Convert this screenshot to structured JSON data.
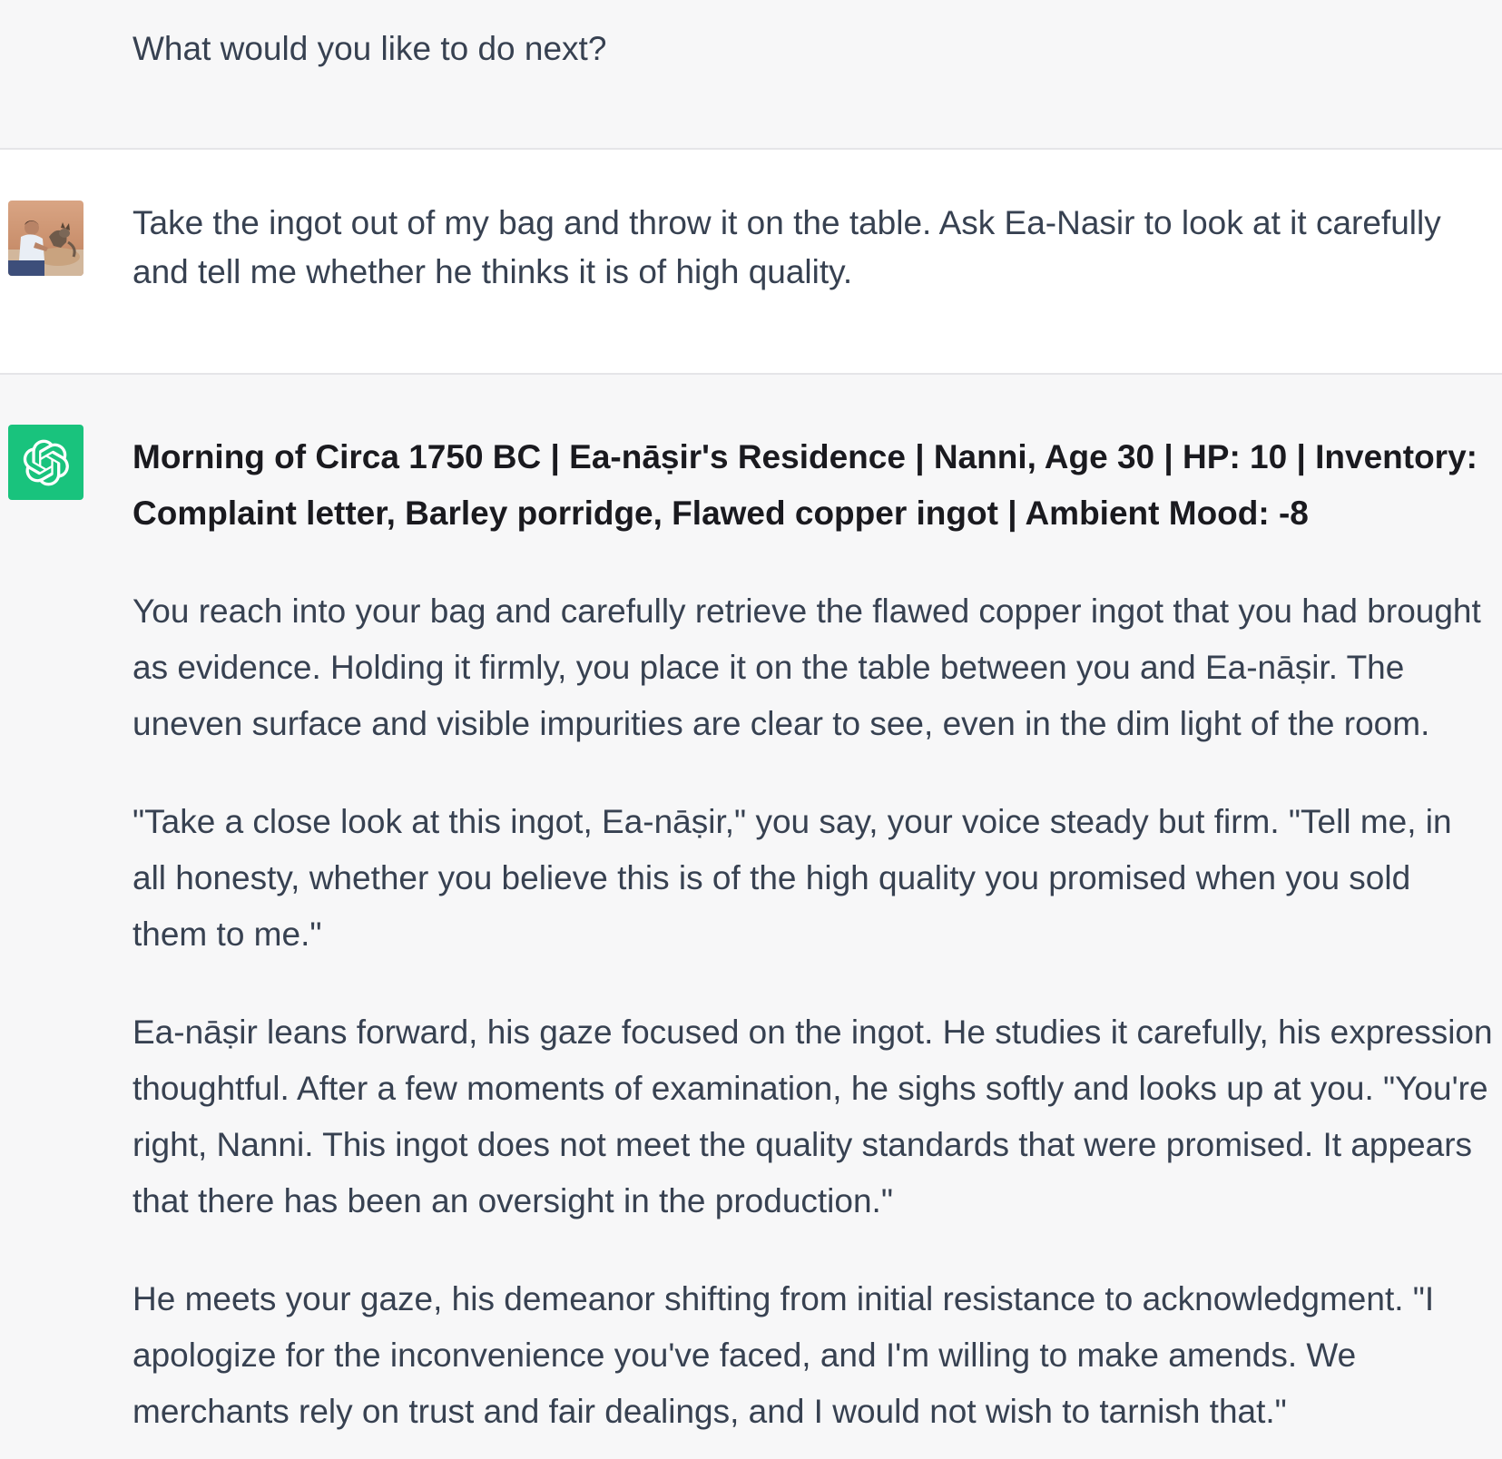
{
  "thread": {
    "previous_assistant_tail": "What would you like to do next?",
    "user_message": "Take the ingot out of my bag and throw it on the table. Ask Ea-Nasir to look at it carefully and tell me whether he thinks it is of high quality.",
    "assistant_reply": {
      "status_line": "Morning of Circa 1750 BC | Ea-nāṣir's Residence | Nanni, Age 30 | HP: 10 | Inventory: Complaint letter, Barley porridge, Flawed copper ingot | Ambient Mood: -8",
      "paragraphs": [
        "You reach into your bag and carefully retrieve the flawed copper ingot that you had brought as evidence. Holding it firmly, you place it on the table between you and Ea-nāṣir. The uneven surface and visible impurities are clear to see, even in the dim light of the room.",
        "\"Take a close look at this ingot, Ea-nāṣir,\" you say, your voice steady but firm. \"Tell me, in all honesty, whether you believe this is of the high quality you promised when you sold them to me.\"",
        "Ea-nāṣir leans forward, his gaze focused on the ingot. He studies it carefully, his expression thoughtful. After a few moments of examination, he sighs softly and looks up at you. \"You're right, Nanni. This ingot does not meet the quality standards that were promised. It appears that there has been an oversight in the production.\"",
        "He meets your gaze, his demeanor shifting from initial resistance to acknowledgment. \"I apologize for the inconvenience you've faced, and I'm willing to make amends. We merchants rely on trust and fair dealings, and I would not wish to tarnish that.\""
      ]
    }
  },
  "icons": {
    "user_avatar": "user-photo-avatar",
    "assistant_avatar": "chatgpt-logo-icon"
  },
  "colors": {
    "assistant_bg": "#f7f7f8",
    "user_bg": "#ffffff",
    "assistant_avatar_bg": "#19c37d",
    "text": "#374151"
  }
}
